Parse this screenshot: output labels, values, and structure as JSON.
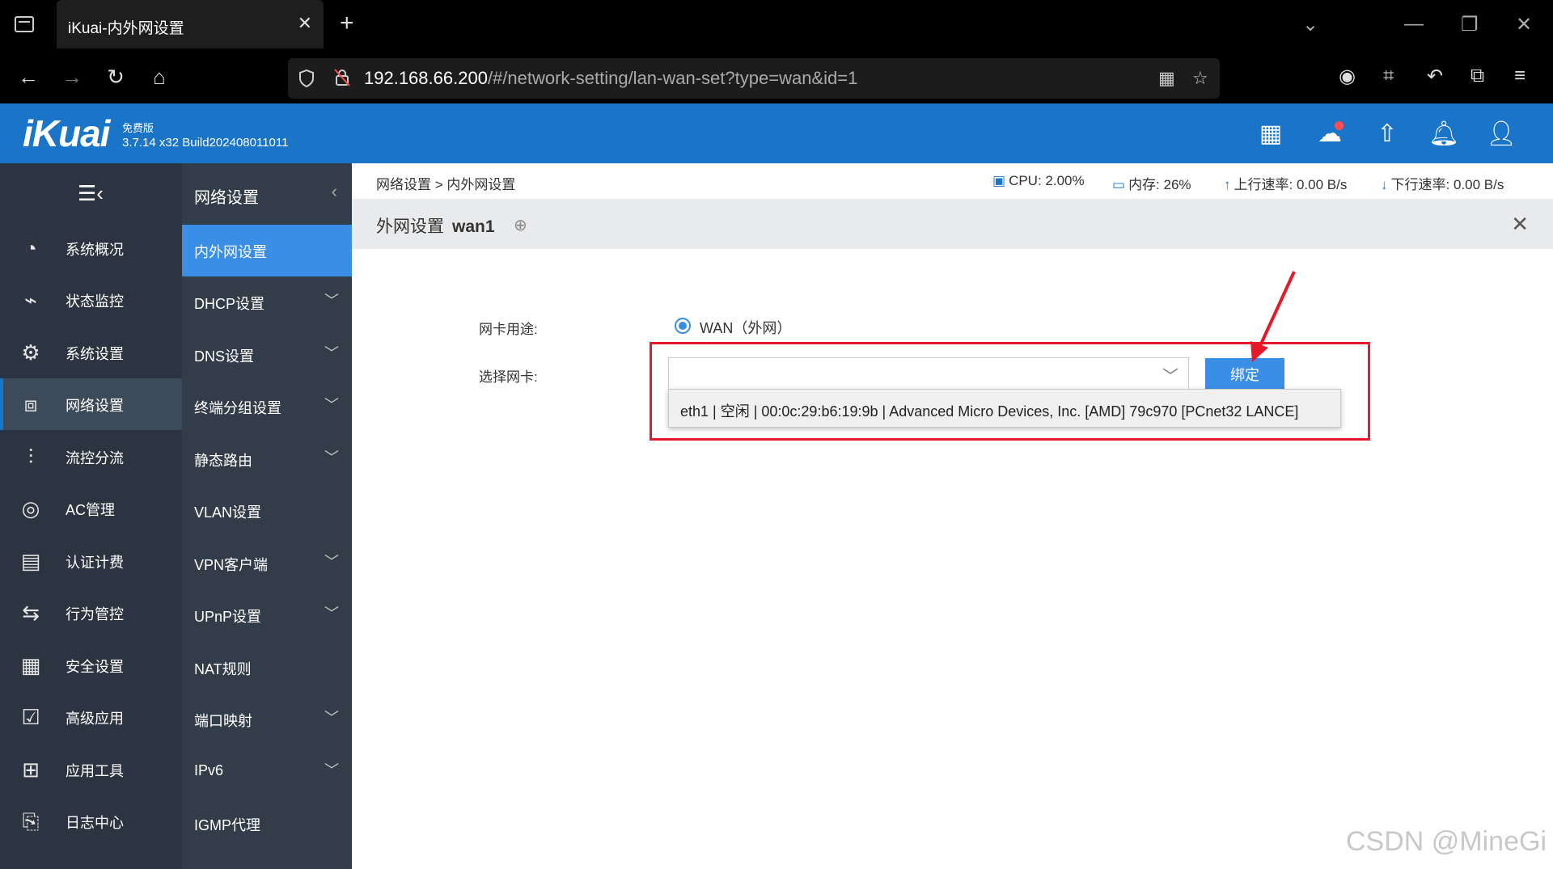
{
  "browser": {
    "tab_title": "iKuai-内外网设置",
    "tab_close": "✕",
    "new_tab": "+",
    "url_host": "192.168.66.200",
    "url_path": "/#/network-setting/lan-wan-set?type=wan&id=1",
    "win_controls": [
      "⌄",
      "—",
      "❐",
      "✕"
    ]
  },
  "header": {
    "logo": "iKuai",
    "edition": "免费版",
    "version": "3.7.14 x32 Build202408011011"
  },
  "sidebar_primary": {
    "items": [
      {
        "label": "系统概况",
        "icon": "dashboard-icon"
      },
      {
        "label": "状态监控",
        "icon": "monitor-icon"
      },
      {
        "label": "系统设置",
        "icon": "gear-icon"
      },
      {
        "label": "网络设置",
        "icon": "network-icon",
        "active": true
      },
      {
        "label": "流控分流",
        "icon": "sliders-icon"
      },
      {
        "label": "AC管理",
        "icon": "wifi-icon"
      },
      {
        "label": "认证计费",
        "icon": "id-card-icon"
      },
      {
        "label": "行为管控",
        "icon": "arrows-icon"
      },
      {
        "label": "安全设置",
        "icon": "firewall-icon"
      },
      {
        "label": "高级应用",
        "icon": "check-window-icon"
      },
      {
        "label": "应用工具",
        "icon": "apps-icon"
      },
      {
        "label": "日志中心",
        "icon": "document-icon"
      }
    ]
  },
  "sidebar_secondary": {
    "title": "网络设置",
    "items": [
      {
        "label": "内外网设置",
        "expandable": false,
        "active": true
      },
      {
        "label": "DHCP设置",
        "expandable": true
      },
      {
        "label": "DNS设置",
        "expandable": true
      },
      {
        "label": "终端分组设置",
        "expandable": true
      },
      {
        "label": "静态路由",
        "expandable": true
      },
      {
        "label": "VLAN设置",
        "expandable": false
      },
      {
        "label": "VPN客户端",
        "expandable": true
      },
      {
        "label": "UPnP设置",
        "expandable": true
      },
      {
        "label": "NAT规则",
        "expandable": false
      },
      {
        "label": "端口映射",
        "expandable": true
      },
      {
        "label": "IPv6",
        "expandable": true
      },
      {
        "label": "IGMP代理",
        "expandable": false
      }
    ]
  },
  "breadcrumb": "网络设置 > 内外网设置",
  "stats": {
    "cpu": "CPU: 2.00%",
    "memory": "内存: 26%",
    "upload": "上行速率: 0.00 B/s",
    "download": "下行速率: 0.00 B/s"
  },
  "panel": {
    "title": "外网设置",
    "name": "wan1"
  },
  "form": {
    "nic_usage_label": "网卡用途:",
    "nic_usage_value": "WAN（外网）",
    "select_nic_label": "选择网卡:",
    "select_value": "",
    "bind_button": "绑定",
    "dropdown_option": "eth1 | 空闲 | 00:0c:29:b6:19:9b | Advanced Micro Devices, Inc. [AMD] 79c970 [PCnet32 LANCE]"
  },
  "watermark": "CSDN @MineGi",
  "colors": {
    "header_blue": "#1a74c7",
    "active_blue": "#3a8ee6",
    "annotation_red": "#e6192a"
  }
}
